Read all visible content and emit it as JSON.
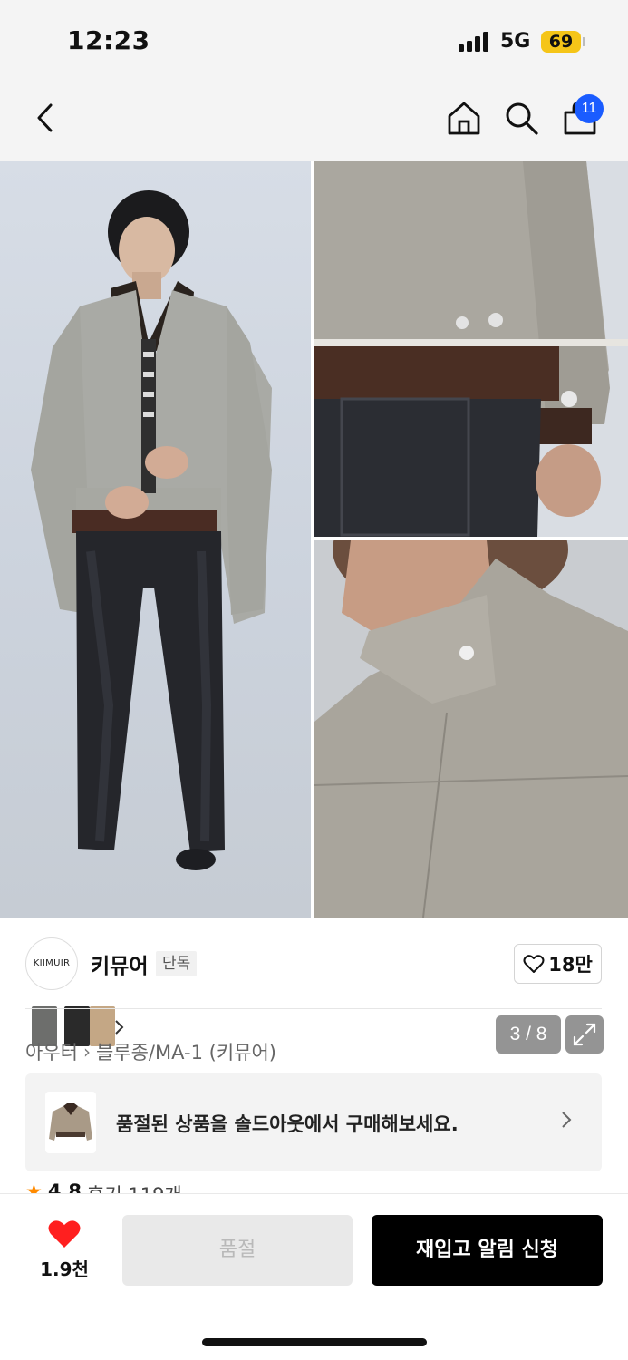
{
  "status_bar": {
    "time": "12:23",
    "network": "5G",
    "battery": "69"
  },
  "header": {
    "icons": [
      "back-icon",
      "home-icon",
      "search-icon",
      "cart-icon"
    ],
    "cart_badge": "11",
    "accent_color": "#1a5cff"
  },
  "gallery": {
    "counter": "3 / 8",
    "thumbnail_swatches": [
      "#6d6e6c",
      "#2a2a2a",
      "#c4a785"
    ],
    "expand_icon": "expand-icon"
  },
  "brand": {
    "logo_text": "KIIMUIR",
    "name": "키뮤어",
    "badge": "단독",
    "likes": "18만"
  },
  "breadcrumb": {
    "items": [
      "아우터",
      "블루종/MA-1 (키뮤어)"
    ]
  },
  "sold_banner": {
    "text": "품절된 상품을 솔드아웃에서 구매해보세요."
  },
  "rating": {
    "score": "4.8",
    "reviews": "후기 119개"
  },
  "bottom_bar": {
    "like_count": "1.9천",
    "heart_color": "#ff1f1f",
    "soldout_label": "품절",
    "restock_label": "재입고 알림 신청"
  }
}
